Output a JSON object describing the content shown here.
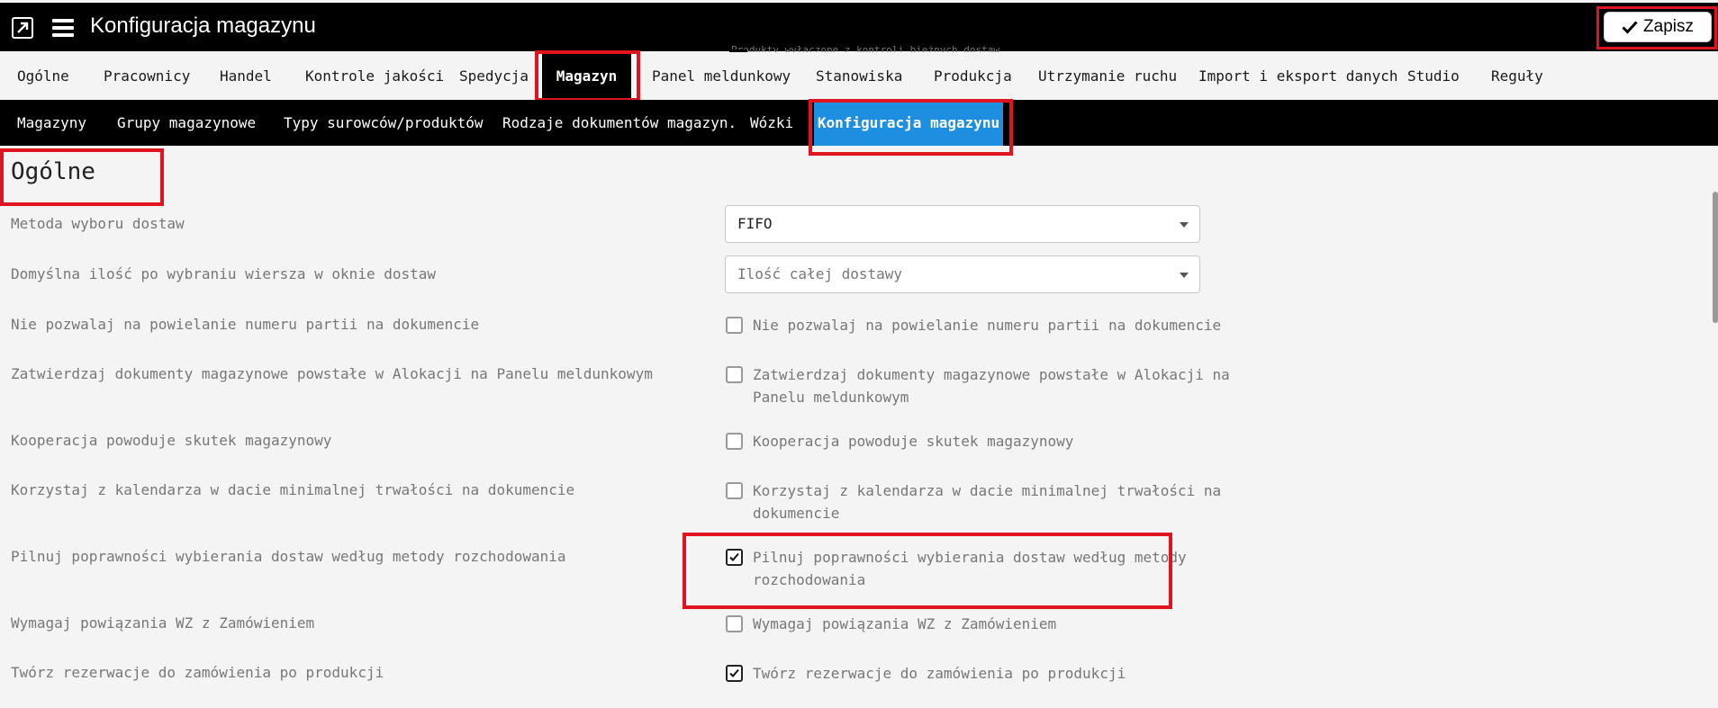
{
  "header": {
    "title": "Konfiguracja magazynu",
    "save_label": "Zapisz",
    "ghost_text": "Produkty wyłączone z kontroli bieżnych dostaw"
  },
  "main_tabs": [
    {
      "label": "Ogólne"
    },
    {
      "label": "Pracownicy"
    },
    {
      "label": "Handel"
    },
    {
      "label": "Kontrole jakości"
    },
    {
      "label": "Spedycja"
    },
    {
      "label": "Magazyn"
    },
    {
      "label": "Panel meldunkowy"
    },
    {
      "label": "Stanowiska"
    },
    {
      "label": "Produkcja"
    },
    {
      "label": "Utrzymanie ruchu"
    },
    {
      "label": "Import i eksport danych"
    },
    {
      "label": "Studio"
    },
    {
      "label": "Reguły"
    }
  ],
  "active_main_tab": "Magazyn",
  "sub_tabs": [
    {
      "label": "Magazyny"
    },
    {
      "label": "Grupy magazynowe"
    },
    {
      "label": "Typy surowców/produktów"
    },
    {
      "label": "Rodzaje dokumentów magazyn."
    },
    {
      "label": "Wózki"
    },
    {
      "label": "Konfiguracja magazynu"
    }
  ],
  "active_sub_tab": "Konfiguracja magazynu",
  "section": {
    "title": "Ogólne",
    "rows": [
      {
        "label": "Metoda wyboru dostaw",
        "control": "select",
        "value": "FIFO"
      },
      {
        "label": "Domyślna ilość po wybraniu wiersza w oknie dostaw",
        "control": "select",
        "value": "Ilość całej dostawy"
      },
      {
        "label": "Nie pozwalaj na powielanie numeru partii na dokumencie",
        "control": "checkbox",
        "checked": false,
        "text_line1": "Nie pozwalaj na powielanie numeru partii na dokumencie",
        "text_line2": ""
      },
      {
        "label": "Zatwierdzaj dokumenty magazynowe powstałe w Alokacji na Panelu meldunkowym",
        "control": "checkbox",
        "checked": false,
        "text_line1": "Zatwierdzaj dokumenty magazynowe powstałe w Alokacji na",
        "text_line2": "Panelu meldunkowym"
      },
      {
        "label": "Kooperacja powoduje skutek magazynowy",
        "control": "checkbox",
        "checked": false,
        "text_line1": "Kooperacja powoduje skutek magazynowy",
        "text_line2": ""
      },
      {
        "label": "Korzystaj z kalendarza w dacie minimalnej trwałości na dokumencie",
        "control": "checkbox",
        "checked": false,
        "text_line1": "Korzystaj z kalendarza w dacie minimalnej trwałości na",
        "text_line2": "dokumencie"
      },
      {
        "label": "Pilnuj poprawności wybierania dostaw według metody rozchodowania",
        "control": "checkbox",
        "checked": true,
        "text_line1": "Pilnuj poprawności wybierania dostaw według metody",
        "text_line2": "rozchodowania"
      },
      {
        "label": "Wymagaj powiązania WZ z Zamówieniem",
        "control": "checkbox",
        "checked": false,
        "text_line1": "Wymagaj powiązania WZ z Zamówieniem",
        "text_line2": ""
      },
      {
        "label": "Twórz rezerwacje do zamówienia po produkcji",
        "control": "checkbox",
        "checked": true,
        "text_line1": "Twórz rezerwacje do zamówienia po produkcji",
        "text_line2": ""
      }
    ]
  },
  "colors": {
    "accent": "#1e8fe0",
    "highlight": "#e0141e",
    "topbar": "#000000"
  },
  "icons": [
    "app-logo-icon",
    "hamburger-menu-icon",
    "checkmark-icon",
    "chevron-down-icon",
    "checkbox-check-icon"
  ]
}
